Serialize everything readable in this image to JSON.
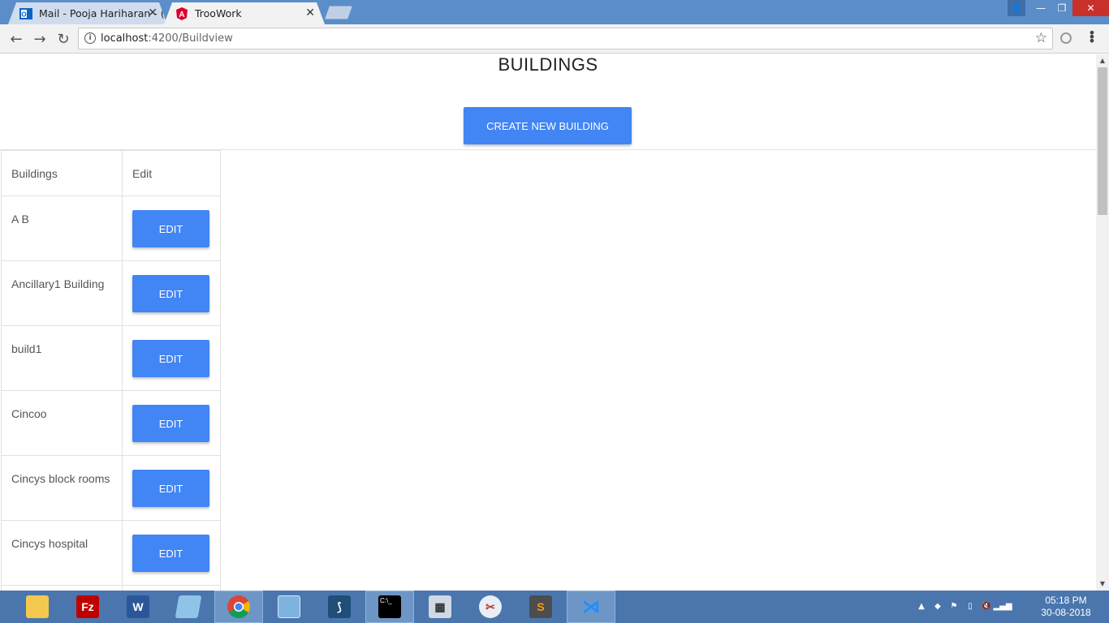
{
  "browser": {
    "tabs": [
      {
        "title": "Mail - Pooja Hariharan - (",
        "active": false,
        "icon": "outlook-icon"
      },
      {
        "title": "TrooWork",
        "active": true,
        "icon": "angular-icon"
      }
    ],
    "url_host": "localhost",
    "url_path": ":4200/Buildview"
  },
  "page": {
    "title": "BUILDINGS",
    "create_button": "CREATE NEW BUILDING",
    "table": {
      "headers": [
        "Buildings",
        "Edit"
      ],
      "rows": [
        {
          "name": "A B",
          "action": "EDIT"
        },
        {
          "name": "Ancillary1 Building",
          "action": "EDIT"
        },
        {
          "name": "build1",
          "action": "EDIT"
        },
        {
          "name": "Cincoo",
          "action": "EDIT"
        },
        {
          "name": "Cincys block rooms",
          "action": "EDIT"
        },
        {
          "name": "Cincys hospital",
          "action": "EDIT"
        },
        {
          "name": "",
          "action": ""
        }
      ]
    }
  },
  "taskbar": {
    "apps": [
      "file-explorer-icon",
      "filezilla-icon",
      "word-icon",
      "notepad-icon",
      "chrome-icon",
      "virtualbox-icon",
      "mysql-workbench-icon",
      "cmd-icon",
      "calculator-icon",
      "snipping-tool-icon",
      "sublime-text-icon",
      "vscode-icon"
    ],
    "time": "05:18 PM",
    "date": "30-08-2018"
  },
  "colors": {
    "accent": "#4285f4",
    "tabstrip": "#5b8ec9",
    "taskbar": "#4a76ad"
  }
}
